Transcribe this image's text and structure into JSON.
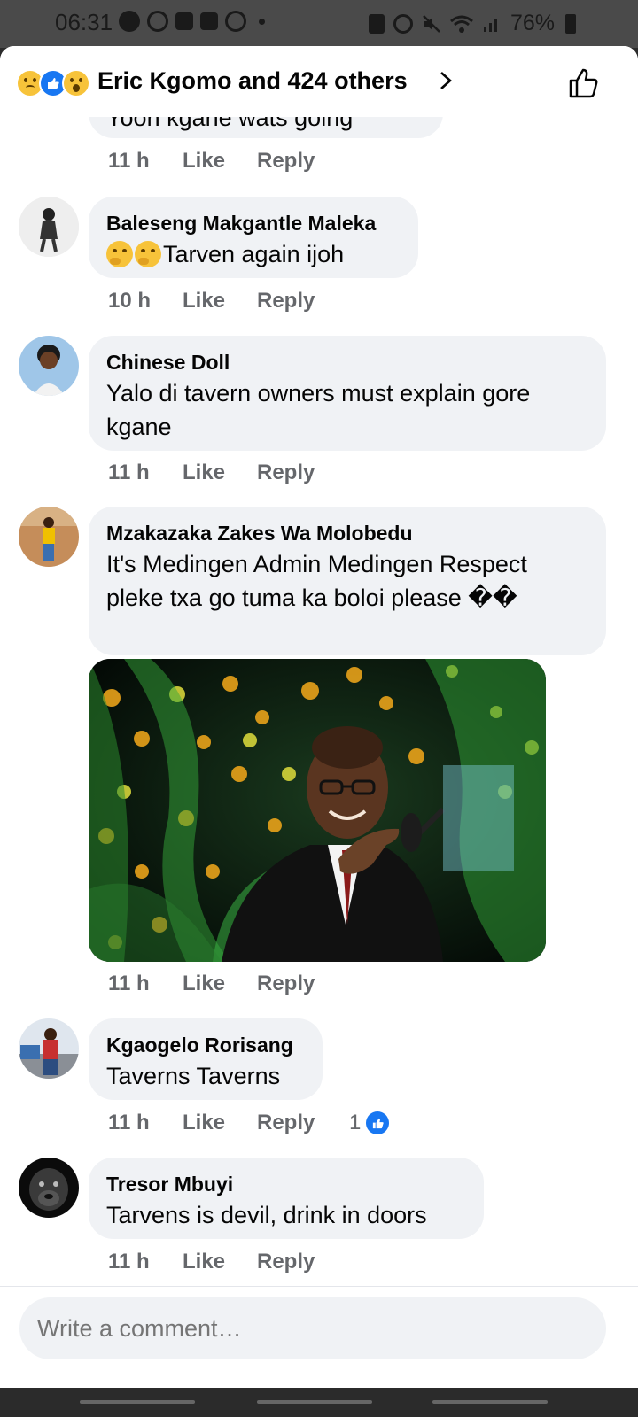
{
  "status_bar": {
    "time": "06:31",
    "battery": "76%"
  },
  "header": {
    "reactions": [
      "sad-reaction-icon",
      "like-reaction-icon",
      "wow-reaction-icon"
    ],
    "title": "Eric Kgomo and 424 others"
  },
  "partial_comment": {
    "text": "Yoon kgane wats going",
    "time": "11 h",
    "like_label": "Like",
    "reply_label": "Reply"
  },
  "comments": [
    {
      "author": "Baleseng Makgantle Maleka",
      "text": "Tarven again ijoh",
      "time": "10 h",
      "like_label": "Like",
      "reply_label": "Reply"
    },
    {
      "author": "Chinese Doll",
      "text": "Yalo di tavern owners must explain gore kgane",
      "time": "11 h",
      "like_label": "Like",
      "reply_label": "Reply"
    },
    {
      "author": "Mzakazaka Zakes Wa Molobedu",
      "text": "It's Medingen Admin Medingen Respect pleke txa go tuma ka boloi please ��",
      "time": "11 h",
      "like_label": "Like",
      "reply_label": "Reply"
    },
    {
      "author": "Kgaogelo Rorisang",
      "text": "Taverns Taverns",
      "time": "11 h",
      "like_label": "Like",
      "reply_label": "Reply",
      "reaction_count": "1"
    },
    {
      "author": "Tresor Mbuyi",
      "text": "Tarvens is devil, drink in doors",
      "time": "11 h",
      "like_label": "Like",
      "reply_label": "Reply"
    }
  ],
  "composer": {
    "placeholder": "Write a comment…"
  },
  "colors": {
    "bubble_bg": "#f0f2f5",
    "meta_text": "#65676b",
    "like_blue": "#1877f2",
    "statusbar_bg": "#4a4a4a"
  }
}
